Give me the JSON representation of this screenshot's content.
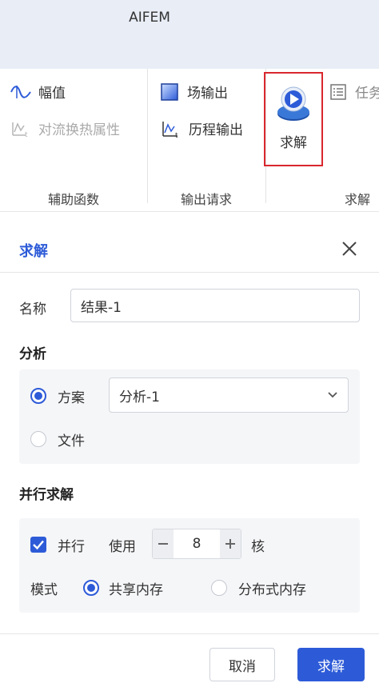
{
  "app": {
    "title": "AIFEM"
  },
  "ribbon": {
    "helper": {
      "label": "辅助函数",
      "amplitude": "幅值",
      "convection": "对流换热属性"
    },
    "output": {
      "label": "输出请求",
      "field": "场输出",
      "history": "历程输出"
    },
    "solve": {
      "label": "求解",
      "solve_button": "求解",
      "task_partial": "任务"
    }
  },
  "dialog": {
    "title": "求解",
    "name_label": "名称",
    "name_value": "结果-1",
    "analysis": {
      "title": "分析",
      "scheme_label": "方案",
      "scheme_value": "分析-1",
      "file_label": "文件",
      "selected": "方案"
    },
    "parallel": {
      "title": "并行求解",
      "checkbox_label": "并行",
      "checked": true,
      "use_label": "使用",
      "cores_value": "8",
      "cores_unit": "核",
      "mode_label": "模式",
      "mode_shared": "共享内存",
      "mode_distributed": "分布式内存",
      "mode_selected": "共享内存"
    },
    "buttons": {
      "cancel": "取消",
      "solve": "求解"
    }
  },
  "colors": {
    "accent": "#2d5bd8",
    "highlight_border": "#d9272e"
  }
}
